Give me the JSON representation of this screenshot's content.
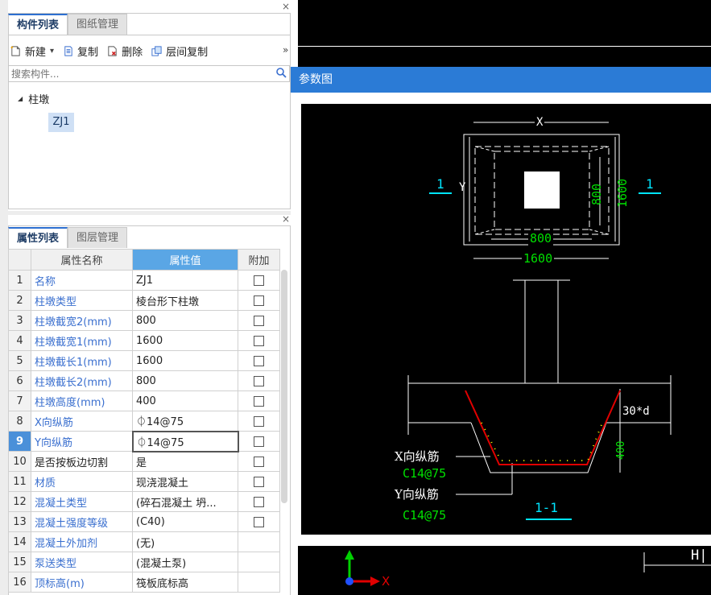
{
  "top_panel": {
    "close": "×",
    "tabs": [
      {
        "label": "构件列表",
        "active": true
      },
      {
        "label": "图纸管理",
        "active": false
      }
    ],
    "toolbar": {
      "new_label": "新建",
      "new_arrow": "▾",
      "copy_label": "复制",
      "delete_label": "删除",
      "floor_copy_label": "层间复制",
      "more": "»"
    },
    "search": {
      "placeholder": "搜索构件..."
    },
    "tree": {
      "root_toggle": "◢",
      "root_label": "柱墩",
      "child_label": "ZJ1"
    }
  },
  "props_panel": {
    "close": "×",
    "tabs": [
      {
        "label": "属性列表",
        "active": true
      },
      {
        "label": "图层管理",
        "active": false
      }
    ],
    "headers": {
      "name": "属性名称",
      "value": "属性值",
      "extra": "附加"
    },
    "rows": [
      {
        "num": "1",
        "name": "名称",
        "value": "ZJ1",
        "link": true,
        "checkbox": true
      },
      {
        "num": "2",
        "name": "柱墩类型",
        "value": "棱台形下柱墩",
        "link": true,
        "checkbox": true
      },
      {
        "num": "3",
        "name": "柱墩截宽2(mm)",
        "value": "800",
        "link": true,
        "checkbox": true
      },
      {
        "num": "4",
        "name": "柱墩截宽1(mm)",
        "value": "1600",
        "link": true,
        "checkbox": true
      },
      {
        "num": "5",
        "name": "柱墩截长1(mm)",
        "value": "1600",
        "link": true,
        "checkbox": true
      },
      {
        "num": "6",
        "name": "柱墩截长2(mm)",
        "value": "800",
        "link": true,
        "checkbox": true
      },
      {
        "num": "7",
        "name": "柱墩高度(mm)",
        "value": "400",
        "link": true,
        "checkbox": true
      },
      {
        "num": "8",
        "name": "X向纵筋",
        "value": "⏀14@75",
        "link": true,
        "checkbox": true
      },
      {
        "num": "9",
        "name": "Y向纵筋",
        "value": "⏀14@75",
        "link": true,
        "checkbox": true,
        "selected": true
      },
      {
        "num": "10",
        "name": "是否按板边切割",
        "value": "是",
        "link": false,
        "checkbox": true
      },
      {
        "num": "11",
        "name": "材质",
        "value": "现浇混凝土",
        "link": true,
        "checkbox": true
      },
      {
        "num": "12",
        "name": "混凝土类型",
        "value": "(碎石混凝土 坍...",
        "link": true,
        "checkbox": true
      },
      {
        "num": "13",
        "name": "混凝土强度等级",
        "value": "(C40)",
        "link": true,
        "checkbox": true
      },
      {
        "num": "14",
        "name": "混凝土外加剂",
        "value": "(无)",
        "link": true,
        "checkbox": false
      },
      {
        "num": "15",
        "name": "泵送类型",
        "value": "(混凝土泵)",
        "link": true,
        "checkbox": false
      },
      {
        "num": "16",
        "name": "顶标高(m)",
        "value": "筏板底标高",
        "link": true,
        "checkbox": false
      }
    ]
  },
  "dialog": {
    "title": "参数图",
    "plan": {
      "x_label": "X",
      "y_label": "Y",
      "dim_inner_w": "800",
      "dim_outer_w": "1600",
      "dim_inner_h": "800",
      "dim_outer_h": "1600",
      "section_mark": "1"
    },
    "section": {
      "dim_anchor": "30*d",
      "dim_height": "400",
      "x_rebar_label": "X向纵筋",
      "x_rebar_value": "C14@75",
      "y_rebar_label": "Y向纵筋",
      "y_rebar_value": "C14@75",
      "section_title": "1-1"
    }
  },
  "canvas": {
    "axis_x_label": "X",
    "corner_text": "H|"
  },
  "colors": {
    "accent_blue": "#2b7bd6",
    "link_blue": "#3a6fcf",
    "cad_bg": "#000000",
    "cad_line": "#ffffff",
    "cad_cyan": "#00e5ff",
    "cad_green": "#00e000",
    "cad_red": "#e00000",
    "cad_yellow": "#ffff00"
  }
}
